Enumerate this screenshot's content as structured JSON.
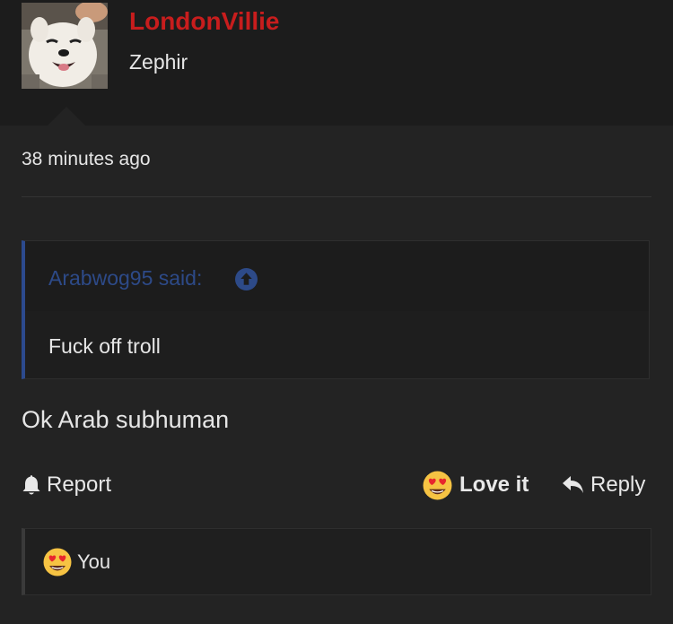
{
  "post": {
    "author": "LondonVillie",
    "author_title": "Zephir",
    "timestamp": "38 minutes ago",
    "quote": {
      "author_said": "Arabwog95 said:",
      "text": "Fuck off troll"
    },
    "message": "Ok Arab subhuman",
    "actions": {
      "report": "Report",
      "love": "Love it",
      "reply": "Reply"
    },
    "reactions": {
      "user": "You"
    }
  },
  "colors": {
    "username": "#c81d1d",
    "quote_accent": "#2c4a8e",
    "background": "#1c1c1c"
  },
  "icons": {
    "quote_link": "arrow-up-circle-icon",
    "report": "bell-icon",
    "love": "heart-eyes-emoji-icon",
    "reply": "reply-arrow-icon"
  }
}
